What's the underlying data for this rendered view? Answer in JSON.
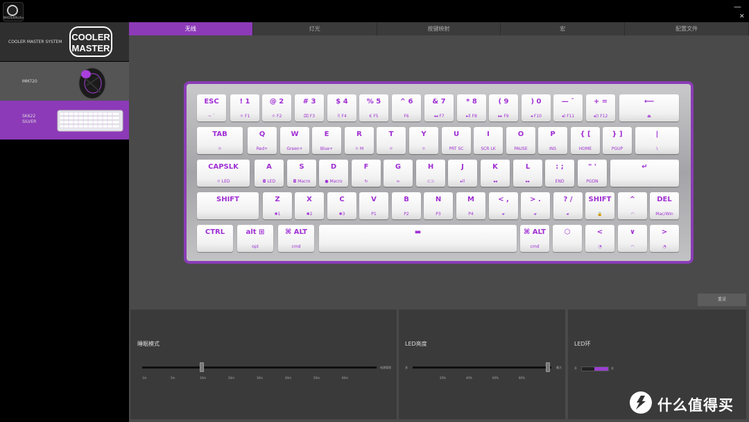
{
  "app": {
    "logo_text": "MASTERPLUS+"
  },
  "window": {
    "minimize_label": "—",
    "close_label": "✕"
  },
  "sidebar": {
    "items": [
      {
        "label": "COOLER MASTER SYSTEM",
        "logo_text": "COOLER MASTER"
      },
      {
        "label": "MM720"
      },
      {
        "label": "SK622\nSILVER"
      }
    ]
  },
  "tabs": [
    "无线",
    "灯光",
    "按键映射",
    "宏",
    "配置文件"
  ],
  "keyboard": {
    "rows": [
      [
        {
          "main": "ESC",
          "sub": "~ `"
        },
        {
          "main": "! 1",
          "sub": "☼ F1"
        },
        {
          "main": "@ 2",
          "sub": "☼ F2"
        },
        {
          "main": "# 3",
          "sub": "⌧ F3"
        },
        {
          "main": "$ 4",
          "sub": "⠿ F4"
        },
        {
          "main": "% 5",
          "sub": "€  F5"
        },
        {
          "main": "^ 6",
          "sub": "F6"
        },
        {
          "main": "& 7",
          "sub": "◂◂ F7"
        },
        {
          "main": "* 8",
          "sub": "▸ll F8"
        },
        {
          "main": "( 9",
          "sub": "▸▸ F9"
        },
        {
          "main": ") 0",
          "sub": "◂ F10"
        },
        {
          "main": "— ¯",
          "sub": "◂) F11"
        },
        {
          "main": "+ =",
          "sub": "◂)) F12"
        },
        {
          "main": "⟵",
          "sub": "⏏"
        }
      ],
      [
        {
          "main": "TAB",
          "sub": "☼"
        },
        {
          "main": "Q",
          "sub": "Red+"
        },
        {
          "main": "W",
          "sub": "Green+"
        },
        {
          "main": "E",
          "sub": "Blue+"
        },
        {
          "main": "R",
          "sub": "☼ M"
        },
        {
          "main": "T",
          "sub": "☼"
        },
        {
          "main": "Y",
          "sub": "☼"
        },
        {
          "main": "U",
          "sub": "PRT SC"
        },
        {
          "main": "I",
          "sub": "SCR LK"
        },
        {
          "main": "O",
          "sub": "PAUSE"
        },
        {
          "main": "P",
          "sub": "INS"
        },
        {
          "main": "{ [",
          "sub": "HOME"
        },
        {
          "main": "} ]",
          "sub": "PGUP"
        },
        {
          "main": "|",
          "sub": "\\"
        }
      ],
      [
        {
          "main": "CAPSLK",
          "sub": "☼ LED"
        },
        {
          "main": "A",
          "sub": "◘ LED"
        },
        {
          "main": "S",
          "sub": "◘ Macro"
        },
        {
          "main": "D",
          "sub": "● Macro"
        },
        {
          "main": "F",
          "sub": "↻"
        },
        {
          "main": "G",
          "sub": "∞"
        },
        {
          "main": "H",
          "sub": "⊂⊃"
        },
        {
          "main": "J",
          "sub": "▸ll"
        },
        {
          "main": "K",
          "sub": "◂◂"
        },
        {
          "main": "L",
          "sub": "▸▸"
        },
        {
          "main": ": ;",
          "sub": "END"
        },
        {
          "main": "\" '",
          "sub": "PGDN"
        },
        {
          "main": "↵",
          "sub": ""
        }
      ],
      [
        {
          "main": "SHIFT",
          "sub": ""
        },
        {
          "main": "Z",
          "sub": "✱1"
        },
        {
          "main": "X",
          "sub": "✱2"
        },
        {
          "main": "C",
          "sub": "✱3"
        },
        {
          "main": "V",
          "sub": "P1"
        },
        {
          "main": "B",
          "sub": "P2"
        },
        {
          "main": "N",
          "sub": "P3"
        },
        {
          "main": "M",
          "sub": "P4"
        },
        {
          "main": "< ,",
          "sub": "◂·"
        },
        {
          "main": "> .",
          "sub": "◂·"
        },
        {
          "main": "? /",
          "sub": "◂·"
        },
        {
          "main": "SHIFT",
          "sub": "🔒"
        },
        {
          "main": "^",
          "sub": "◠"
        },
        {
          "main": "DEL",
          "sub": "Mac/Win"
        }
      ],
      [
        {
          "main": "CTRL",
          "sub": ""
        },
        {
          "main": "alt ⊞",
          "sub": "opt"
        },
        {
          "main": "⌘ ALT",
          "sub": "cmd"
        },
        {
          "main": "▬",
          "sub": ""
        },
        {
          "main": "⌘ ALT",
          "sub": "cmd"
        },
        {
          "main": "⬡",
          "sub": ""
        },
        {
          "main": "<",
          "sub": "◔"
        },
        {
          "main": "∨",
          "sub": "◠"
        },
        {
          "main": ">",
          "sub": "◔"
        }
      ]
    ]
  },
  "reset_label": "重设",
  "panels": {
    "sleep": {
      "title": "睡眠模式",
      "end_label": "电源管理",
      "ticks": [
        "1m",
        "5m",
        "10m",
        "20m",
        "30m",
        "40m",
        "50m",
        "60m"
      ],
      "value_label": "10m"
    },
    "brightness": {
      "title": "LED亮度",
      "min_label": "关",
      "max_label": "最大",
      "ticks": [
        "20%",
        "40%",
        "60%",
        "80%"
      ],
      "value": 1.0
    },
    "led_ring": {
      "title": "LED环",
      "off_label": "开",
      "on_label": "关"
    }
  },
  "watermark": {
    "logo_text": "值",
    "text": "什么值得买"
  }
}
